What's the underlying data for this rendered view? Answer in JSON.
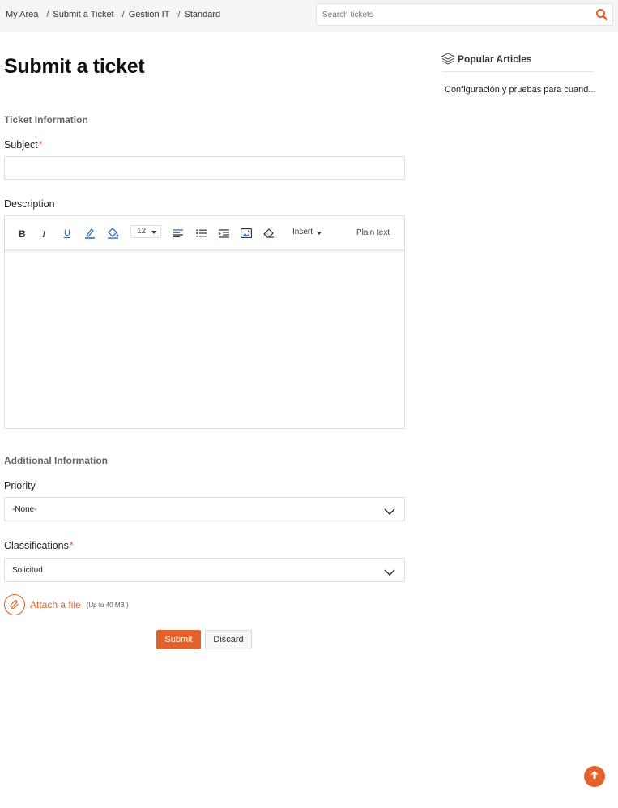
{
  "breadcrumb": {
    "items": [
      "My Area",
      "Submit a Ticket",
      "Gestion IT",
      "Standard"
    ],
    "separator": "/"
  },
  "search": {
    "placeholder": "Search tickets",
    "icon": "search-icon"
  },
  "page": {
    "title": "Submit a ticket"
  },
  "ticket_info": {
    "section_title": "Ticket Information",
    "subject_label": "Subject",
    "subject_value": "",
    "required_marker": "*",
    "description_label": "Description"
  },
  "editor": {
    "tools": [
      "bold-icon",
      "italic-icon",
      "underline-icon",
      "text-color-icon",
      "background-color-icon",
      "align-left-icon",
      "bullet-list-icon",
      "indent-icon",
      "image-icon",
      "clear-format-icon"
    ],
    "font_size": "12",
    "insert_label": "Insert",
    "plain_text_label": "Plain text",
    "body": ""
  },
  "additional_info": {
    "section_title": "Additional Information",
    "priority_label": "Priority",
    "priority_value": "-None-",
    "classifications_label": "Classifications",
    "classifications_value": "Solicitud"
  },
  "attach": {
    "label": "Attach a file",
    "note": "(Up to 40 MB )"
  },
  "actions": {
    "submit_label": "Submit",
    "discard_label": "Discard"
  },
  "sidebar": {
    "title": "Popular Articles",
    "articles": [
      "Configuración y pruebas para cuand..."
    ]
  },
  "colors": {
    "accent": "#e2622b",
    "topbar_bg": "#f5f5f5",
    "border": "#e0e0e0"
  }
}
